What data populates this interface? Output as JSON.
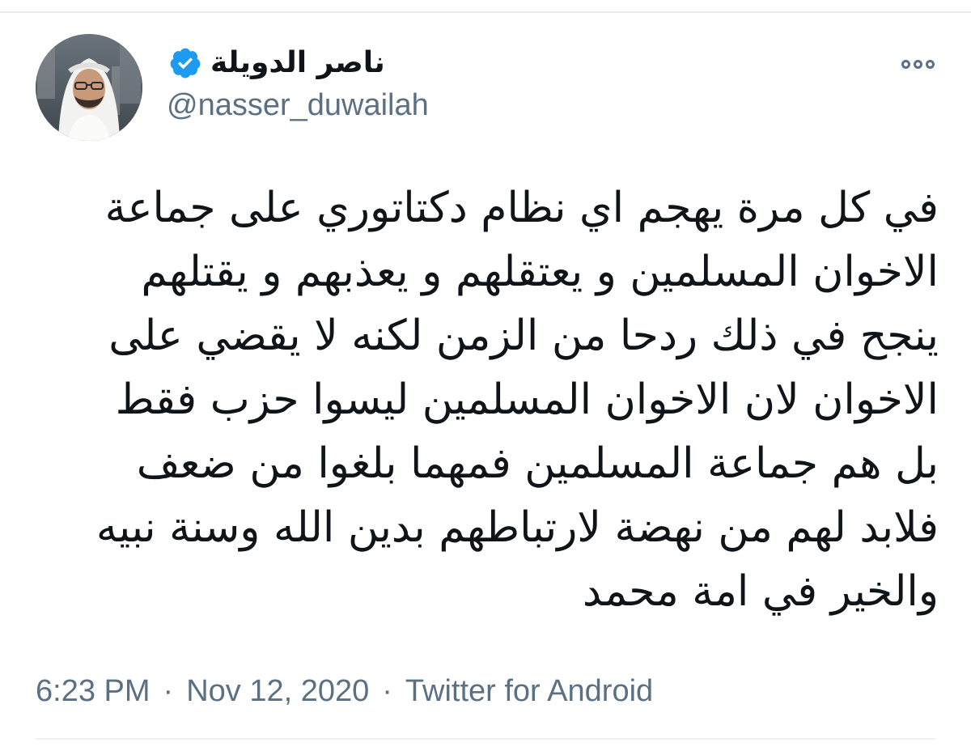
{
  "tweet": {
    "author": {
      "display_name": "ناصر الدويلة",
      "handle": "@nasser_duwailah",
      "verified": true,
      "avatar_icon": "profile-photo"
    },
    "text_lines": [
      "في كل مرة يهجم اي نظام دكتاتوري على جماعة",
      "الاخوان المسلمين و يعتقلهم و يعذبهم و يقتلهم",
      "ينجح في ذلك ردحا من الزمن لكنه لا يقضي على",
      "الاخوان لان الاخوان المسلمين ليسوا حزب فقط",
      "بل هم جماعة المسلمين فمهما بلغوا من ضعف",
      "فلابد لهم من نهضة لارتباطهم بدين الله وسنة نبيه",
      "والخير في امة محمد"
    ],
    "meta": {
      "time": "6:23 PM",
      "separator": "·",
      "date": "Nov 12, 2020",
      "source": "Twitter for Android"
    }
  },
  "icons": {
    "verified": "verified-badge-icon",
    "more": "more-options-icon"
  },
  "colors": {
    "verified_blue": "#1d9bf0",
    "text_primary": "#0f1419",
    "text_secondary": "#5b7083",
    "divider": "#e6ecf0"
  }
}
